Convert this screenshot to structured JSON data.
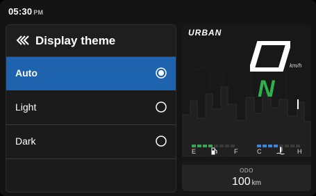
{
  "status": {
    "time": "05:30",
    "ampm": "PM"
  },
  "panel": {
    "title": "Display theme",
    "options": [
      {
        "label": "Auto",
        "selected": true
      },
      {
        "label": "Light",
        "selected": false
      },
      {
        "label": "Dark",
        "selected": false
      }
    ]
  },
  "cluster": {
    "brand": "URBAN",
    "speed_unit": "km/h",
    "gear": "N",
    "fuel": {
      "empty_label": "E",
      "full_label": "F",
      "level_segments": 4,
      "total_segments": 8
    },
    "temp": {
      "cold_label": "C",
      "hot_label": "H",
      "level_segments": 4,
      "total_segments": 8
    },
    "odo": {
      "label": "ODO",
      "value": "100",
      "unit": "km"
    },
    "colors": {
      "accent_blue": "#1d63ad",
      "gear_green": "#2eb34a",
      "fuel_green": "#3ca552",
      "temp_blue": "#3b86d6"
    }
  }
}
